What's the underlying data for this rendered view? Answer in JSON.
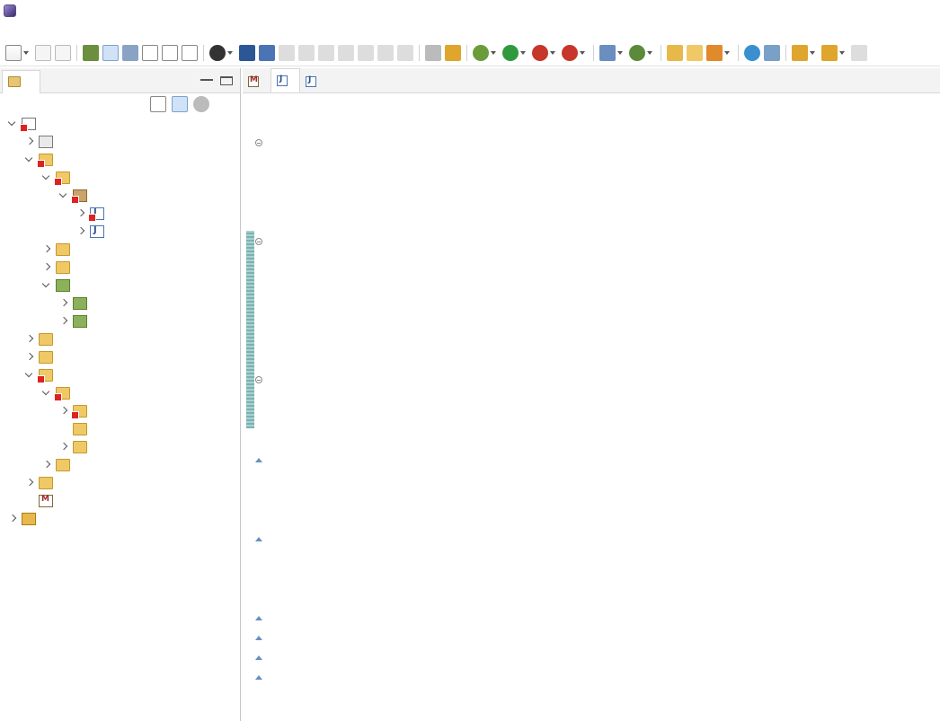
{
  "window": {
    "title": ""
  },
  "menu": [
    {
      "label": "",
      "name": "menu-file"
    },
    {
      "label": "",
      "name": "menu-edit"
    },
    {
      "label": "",
      "name": "menu-source"
    },
    {
      "label": "",
      "name": "menu-refactor"
    },
    {
      "label": "",
      "name": "menu-navigate"
    },
    {
      "label": "",
      "name": "menu-search"
    },
    {
      "label": "",
      "name": "menu-project"
    },
    {
      "label": "",
      "name": "menu-run"
    },
    {
      "label": "",
      "name": "menu-window"
    },
    {
      "label": "",
      "name": "menu-help"
    }
  ],
  "explorer": {
    "tab_label": "",
    "tab_close": "",
    "items": [
      {
        "label": "",
        "indent": 0,
        "state": "open",
        "icon": "project-icon",
        "error": true
      },
      {
        "label": "",
        "indent": 1,
        "state": "closed",
        "icon": "descriptor-icon",
        "error": false
      },
      {
        "label": "",
        "indent": 1,
        "state": "open",
        "icon": "java-resources-icon",
        "error": true
      },
      {
        "label": "",
        "indent": 2,
        "state": "open",
        "icon": "source-folder-icon",
        "error": true
      },
      {
        "label": "",
        "indent": 3,
        "state": "open",
        "icon": "package-icon",
        "error": true
      },
      {
        "label": "",
        "indent": 4,
        "state": "closed",
        "icon": "java-file-icon",
        "error": true,
        "selected": true
      },
      {
        "label": "",
        "indent": 4,
        "state": "closed",
        "icon": "java-file-icon",
        "error": false
      },
      {
        "label": "",
        "indent": 2,
        "state": "closed",
        "icon": "source-folder-icon",
        "error": false
      },
      {
        "label": "",
        "indent": 2,
        "state": "closed",
        "icon": "source-folder-icon",
        "error": false
      },
      {
        "label": "",
        "indent": 2,
        "state": "open",
        "icon": "library-icon",
        "error": false
      },
      {
        "label": "",
        "indent": 3,
        "state": "closed",
        "icon": "library-icon",
        "error": false,
        "decor": ""
      },
      {
        "label": "",
        "indent": 3,
        "state": "closed",
        "icon": "library-icon",
        "error": false
      },
      {
        "label": "",
        "indent": 1,
        "state": "closed",
        "icon": "js-resources-icon",
        "error": false
      },
      {
        "label": "",
        "indent": 1,
        "state": "closed",
        "icon": "deployed-resources-icon",
        "error": false
      },
      {
        "label": "",
        "indent": 1,
        "state": "open",
        "icon": "folder-icon",
        "error": true
      },
      {
        "label": "",
        "indent": 2,
        "state": "open",
        "icon": "folder-icon",
        "error": true
      },
      {
        "label": "",
        "indent": 3,
        "state": "closed",
        "icon": "folder-icon",
        "error": true
      },
      {
        "label": "",
        "indent": 3,
        "state": "none",
        "icon": "folder-icon",
        "error": false
      },
      {
        "label": "",
        "indent": 3,
        "state": "closed",
        "icon": "folder-icon",
        "error": false
      },
      {
        "label": "",
        "indent": 2,
        "state": "closed",
        "icon": "folder-icon",
        "error": false
      },
      {
        "label": "",
        "indent": 1,
        "state": "closed",
        "icon": "folder-icon",
        "error": false
      },
      {
        "label": "",
        "indent": 1,
        "state": "none",
        "icon": "xml-file-icon",
        "error": false
      },
      {
        "label": "",
        "indent": 0,
        "state": "closed",
        "icon": "servers-icon",
        "error": false
      }
    ]
  },
  "editor": {
    "tabs": [
      {
        "label": "",
        "icon": "xml",
        "active": false,
        "close": ""
      },
      {
        "label": "",
        "icon": "java",
        "active": true,
        "close": ""
      },
      {
        "label": "",
        "icon": "java",
        "active": false,
        "close": ""
      }
    ],
    "current_line": 16,
    "error_line": 16,
    "lines": [
      {
        "n": "",
        "fold": "",
        "tokens": [
          [
            "kw",
            ""
          ],
          [
            "",
            ""
          ]
        ]
      },
      {
        "n": "",
        "fold": "",
        "tokens": []
      },
      {
        "n": "",
        "fold": "minus",
        "tokens": [
          [
            "kw",
            ""
          ],
          [
            "",
            ""
          ]
        ]
      },
      {
        "n": "",
        "fold": "",
        "tokens": [
          [
            "kw",
            ""
          ],
          [
            "",
            ""
          ]
        ]
      },
      {
        "n": "",
        "fold": "",
        "tokens": []
      },
      {
        "n": "",
        "fold": "",
        "tokens": [
          [
            "kw",
            ""
          ],
          [
            "",
            " "
          ],
          [
            "kw",
            ""
          ],
          [
            "",
            ""
          ],
          [
            "kw",
            ""
          ],
          [
            "",
            ""
          ]
        ]
      },
      {
        "n": "",
        "fold": "",
        "tokens": []
      },
      {
        "n": "",
        "fold": "minus",
        "tokens": [
          [
            "cm",
            ""
          ]
        ]
      },
      {
        "n": "",
        "fold": "",
        "tokens": [
          [
            "cm",
            ""
          ],
          [
            "cm cjk",
            ""
          ],
          [
            "cm",
            ""
          ],
          [
            "cm cjk",
            ""
          ],
          [
            "cm",
            ""
          ],
          [
            "cm cjk",
            ""
          ]
        ]
      },
      {
        "n": "",
        "fold": "",
        "tokens": [
          [
            "cm",
            ""
          ],
          [
            "cm cjk",
            ""
          ],
          [
            "cm",
            ""
          ],
          [
            "cm cjk",
            ""
          ],
          [
            "cm",
            ""
          ],
          [
            "cm cjk",
            ""
          ]
        ]
      },
      {
        "n": "",
        "fold": "",
        "tokens": [
          [
            "cm",
            ""
          ]
        ]
      },
      {
        "n": "",
        "fold": "",
        "tokens": [
          [
            "cm",
            ""
          ],
          [
            "cm cjk",
            ""
          ],
          [
            "cm",
            ""
          ],
          [
            "cm cjk",
            ""
          ],
          [
            "cm",
            ""
          ],
          [
            "cm cjk",
            ""
          ]
        ]
      },
      {
        "n": "",
        "fold": "",
        "tokens": [
          [
            "cm",
            ""
          ],
          [
            "cm cjk",
            ""
          ],
          [
            "cm",
            ""
          ],
          [
            "cm cjk",
            ""
          ]
        ]
      },
      {
        "n": "",
        "fold": "",
        "tokens": [
          [
            "cm",
            ""
          ]
        ]
      },
      {
        "n": "",
        "fold": "minus",
        "tokens": [
          [
            "",
            "    "
          ],
          [
            "kw",
            ""
          ],
          [
            "",
            " "
          ],
          [
            "kw",
            ""
          ],
          [
            "",
            " "
          ],
          [
            "kw",
            ""
          ],
          [
            "",
            ""
          ],
          [
            "prm",
            ""
          ],
          [
            "",
            ""
          ]
        ]
      },
      {
        "n": "",
        "fold": "",
        "tokens": [
          [
            "",
            "        "
          ],
          [
            "err-text",
            ""
          ],
          [
            "",
            ""
          ],
          [
            "kw",
            ""
          ],
          [
            "",
            ""
          ],
          [
            "kw",
            ""
          ],
          [
            "",
            ""
          ]
        ]
      },
      {
        "n": "",
        "fold": "",
        "tokens": [
          [
            "",
            ""
          ]
        ]
      },
      {
        "n": "",
        "fold": "",
        "tokens": []
      },
      {
        "n": "",
        "fold": "plus",
        "tokens": [
          [
            "",
            "    "
          ],
          [
            "kw",
            ""
          ],
          [
            "",
            " "
          ],
          [
            "kw",
            ""
          ],
          [
            "",
            ""
          ],
          [
            "prm",
            ""
          ],
          [
            "",
            ""
          ]
        ]
      },
      {
        "n": "",
        "fold": "",
        "tokens": [
          [
            "",
            "        "
          ],
          [
            "prm",
            ""
          ],
          [
            "",
            ""
          ],
          [
            "kw",
            ""
          ],
          [
            "",
            ""
          ]
        ]
      },
      {
        "n": "",
        "fold": "",
        "tokens": [
          [
            "",
            ""
          ]
        ]
      },
      {
        "n": "",
        "fold": "",
        "tokens": []
      },
      {
        "n": "",
        "fold": "plus",
        "tokens": [
          [
            "",
            "    "
          ],
          [
            "kw",
            ""
          ],
          [
            "",
            " "
          ],
          [
            "kw",
            ""
          ],
          [
            "",
            ""
          ],
          [
            "prm",
            ""
          ],
          [
            "",
            ""
          ]
        ]
      },
      {
        "n": "",
        "fold": "",
        "tokens": [
          [
            "",
            "        "
          ],
          [
            "prm",
            ""
          ],
          [
            "",
            ""
          ],
          [
            "str",
            ""
          ],
          [
            "",
            ""
          ],
          [
            "kw",
            ""
          ],
          [
            "",
            ""
          ]
        ]
      },
      {
        "n": "",
        "fold": "",
        "tokens": [
          [
            "",
            ""
          ]
        ]
      },
      {
        "n": "",
        "fold": "",
        "tokens": []
      },
      {
        "n": "",
        "fold": "plus",
        "tokens": [
          [
            "",
            "    "
          ],
          [
            "kw",
            ""
          ],
          [
            "",
            " "
          ],
          [
            "kw",
            ""
          ],
          [
            "",
            ""
          ],
          [
            "prm",
            ""
          ],
          [
            "",
            ""
          ]
        ]
      },
      {
        "n": "",
        "fold": "plus",
        "tokens": [
          [
            "",
            "    "
          ],
          [
            "kw",
            ""
          ],
          [
            "",
            " "
          ],
          [
            "kw",
            ""
          ],
          [
            "",
            ""
          ],
          [
            "prm",
            ""
          ],
          [
            "",
            ""
          ]
        ]
      },
      {
        "n": "",
        "fold": "plus",
        "tokens": [
          [
            "",
            "    "
          ],
          [
            "kw",
            ""
          ],
          [
            "",
            " "
          ],
          [
            "kw",
            ""
          ],
          [
            "",
            ""
          ],
          [
            "prm",
            ""
          ],
          [
            "",
            ""
          ]
        ]
      },
      {
        "n": "",
        "fold": "plus",
        "tokens": [
          [
            "",
            "    "
          ],
          [
            "kw",
            ""
          ],
          [
            "",
            " "
          ],
          [
            "kw",
            ""
          ],
          [
            "",
            ""
          ],
          [
            "prm",
            ""
          ],
          [
            "",
            ""
          ]
        ]
      },
      {
        "n": "",
        "fold": "",
        "tokens": [
          [
            "",
            ""
          ]
        ]
      }
    ]
  },
  "colors": {
    "keyword": "#7f0055",
    "comment": "#3f5fbf",
    "string": "#2a00ff",
    "param": "#6a3e3e",
    "line_number": "#787878",
    "current_line": "#e8f2fe",
    "selection": "#e3e3e3",
    "error": "#e0182f"
  }
}
